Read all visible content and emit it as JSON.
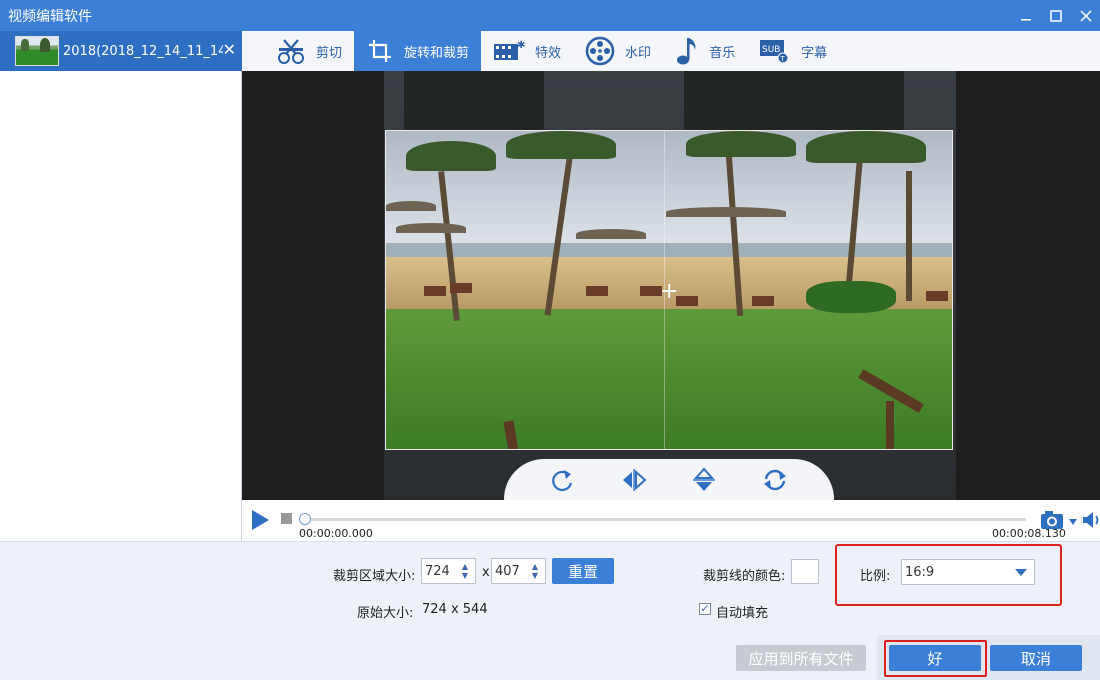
{
  "window": {
    "title": "视频编辑软件",
    "accent": "#3c7fd6"
  },
  "file_list": {
    "items": [
      {
        "name": "2018(2018_12_14_11_14...",
        "selected": true
      }
    ]
  },
  "tabs": [
    {
      "label": "剪切",
      "icon": "scissors-icon",
      "active": false
    },
    {
      "label": "旋转和裁剪",
      "icon": "crop-icon",
      "active": true
    },
    {
      "label": "特效",
      "icon": "effects-icon",
      "active": false
    },
    {
      "label": "水印",
      "icon": "watermark-icon",
      "active": false
    },
    {
      "label": "音乐",
      "icon": "music-note-icon",
      "active": false
    },
    {
      "label": "字幕",
      "icon": "subtitle-icon",
      "active": false
    }
  ],
  "preview": {
    "controls": [
      "rotate-icon",
      "flip-horizontal-icon",
      "flip-vertical-icon",
      "reset-rotate-icon"
    ]
  },
  "timeline": {
    "current_time": "00:00:00.000",
    "end_time": "00:00:08.130"
  },
  "crop": {
    "size_label": "裁剪区域大小:",
    "width": "724",
    "separator": "x",
    "height": "407",
    "reset_label": "重置",
    "original_label": "原始大小:",
    "original_value": "724 x 544",
    "line_color_label": "裁剪线的颜色:",
    "auto_fill_label": "自动填充",
    "auto_fill_checked": true,
    "ratio_label": "比例:",
    "ratio_value": "16:9"
  },
  "footer": {
    "apply_all_label": "应用到所有文件",
    "ok_label": "好",
    "cancel_label": "取消"
  }
}
